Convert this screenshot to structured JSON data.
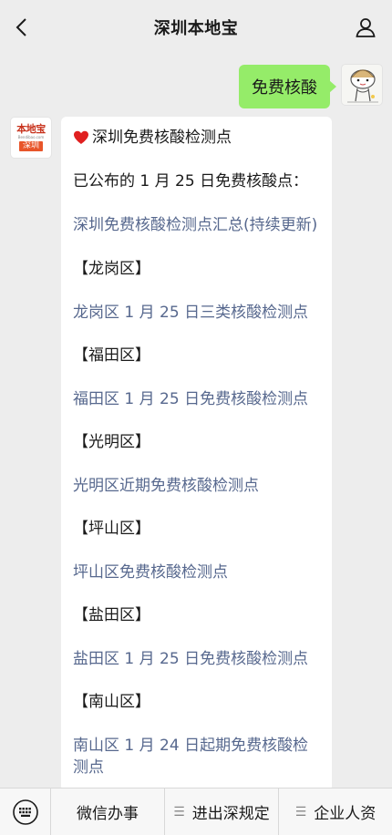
{
  "header": {
    "title": "深圳本地宝",
    "back_icon": "chevron-left-icon",
    "user_icon": "person-icon"
  },
  "outgoing": {
    "text": "免费核酸"
  },
  "bot": {
    "logo_top": "本地宝",
    "logo_url": "Bendibao.com",
    "logo_city": "深圳"
  },
  "message": {
    "heading": "深圳免费核酸检测点",
    "intro": "已公布的 1 月 25 日免费核酸点：",
    "summary_link": "深圳免费核酸检测点汇总(持续更新)",
    "sections": [
      {
        "region": "【龙岗区】",
        "link": "龙岗区 1 月 25 日三类核酸检测点"
      },
      {
        "region": "【福田区】",
        "link": "福田区 1 月 25 日免费核酸检测点"
      },
      {
        "region": "【光明区】",
        "link": "光明区近期免费核酸检测点"
      },
      {
        "region": "【坪山区】",
        "link": "坪山区免费核酸检测点"
      },
      {
        "region": "【盐田区】",
        "link": "盐田区 1 月 25 日免费核酸检测点"
      },
      {
        "region": "【南山区】",
        "link": "南山区 1 月 24 日起期免费核酸检测点"
      }
    ]
  },
  "menu": {
    "keyboard_icon": "keyboard-icon",
    "items": [
      {
        "label": "微信办事",
        "has_icon": false
      },
      {
        "label": "进出深规定",
        "has_icon": true
      },
      {
        "label": "企业人资",
        "has_icon": true
      }
    ]
  },
  "colors": {
    "outgoing_bubble": "#95ec69",
    "link": "#57688e",
    "heart": "#e02020"
  }
}
